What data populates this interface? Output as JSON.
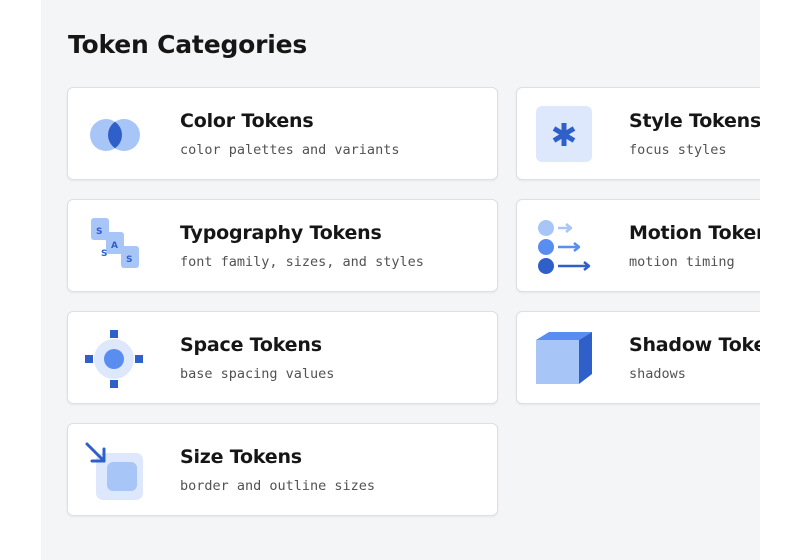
{
  "page": {
    "title": "Token Categories"
  },
  "colors": {
    "primary": "#0f62fe",
    "dark_blue": "#2f5fc9",
    "mid_blue": "#5a8df0",
    "light_blue": "#a8c5f8",
    "pale_blue": "#dde8fd"
  },
  "categories": [
    {
      "title": "Color Tokens",
      "description": "color palettes and variants",
      "icon": "overlapping-circles-icon"
    },
    {
      "title": "Typography Tokens",
      "description": "font family, sizes, and styles",
      "icon": "sass-blocks-icon",
      "icon_letters": [
        "S",
        "A",
        "S",
        "S"
      ]
    },
    {
      "title": "Space Tokens",
      "description": "base spacing values",
      "icon": "spacing-target-icon"
    },
    {
      "title": "Size Tokens",
      "description": "border and outline sizes",
      "icon": "resize-arrow-icon"
    },
    {
      "title": "Style Tokens",
      "description": "focus styles",
      "icon": "asterisk-icon"
    },
    {
      "title": "Motion Tokens",
      "description": "motion timing",
      "icon": "motion-arrows-icon"
    },
    {
      "title": "Shadow Tokens",
      "description": "shadows",
      "icon": "cube-icon"
    }
  ]
}
